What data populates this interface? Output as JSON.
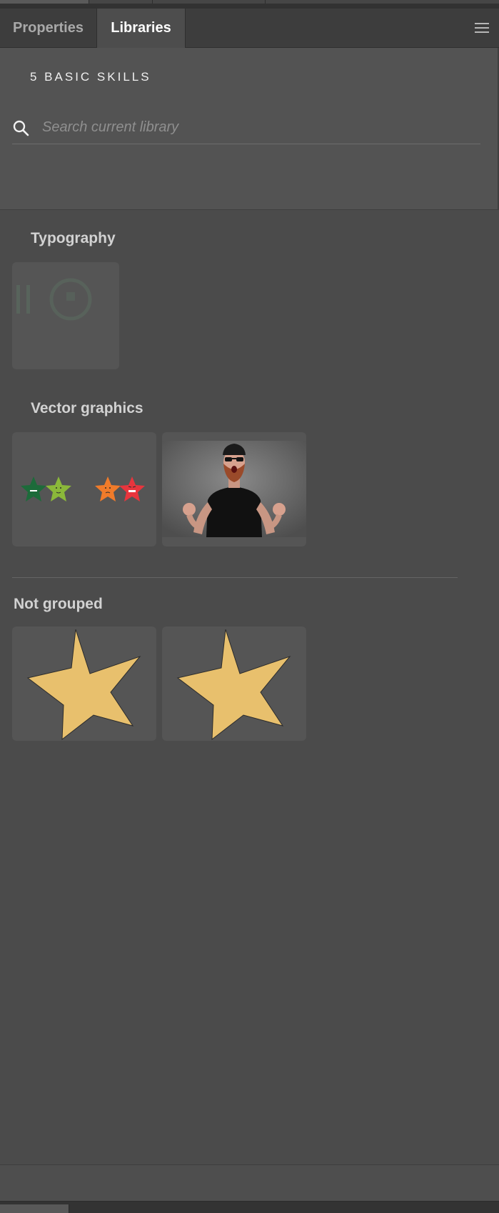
{
  "tabs": {
    "properties": "Properties",
    "libraries": "Libraries"
  },
  "library": {
    "name": "5 BASIC SKILLS"
  },
  "search": {
    "placeholder": "Search current library",
    "value": ""
  },
  "sections": {
    "typography": "Typography",
    "vector_graphics": "Vector graphics",
    "not_grouped": "Not grouped"
  },
  "icons": {
    "search": "search-icon",
    "menu": "hamburger-menu-icon"
  },
  "colors": {
    "panel_bg": "#4b4b4b",
    "header_bg": "#535353",
    "tile_bg": "#555555",
    "star_fill": "#e8c06d",
    "star_dark_green": "#1d6b3a",
    "star_light_green": "#8bb83a",
    "star_orange": "#f07b2a",
    "star_red": "#e8353d"
  }
}
